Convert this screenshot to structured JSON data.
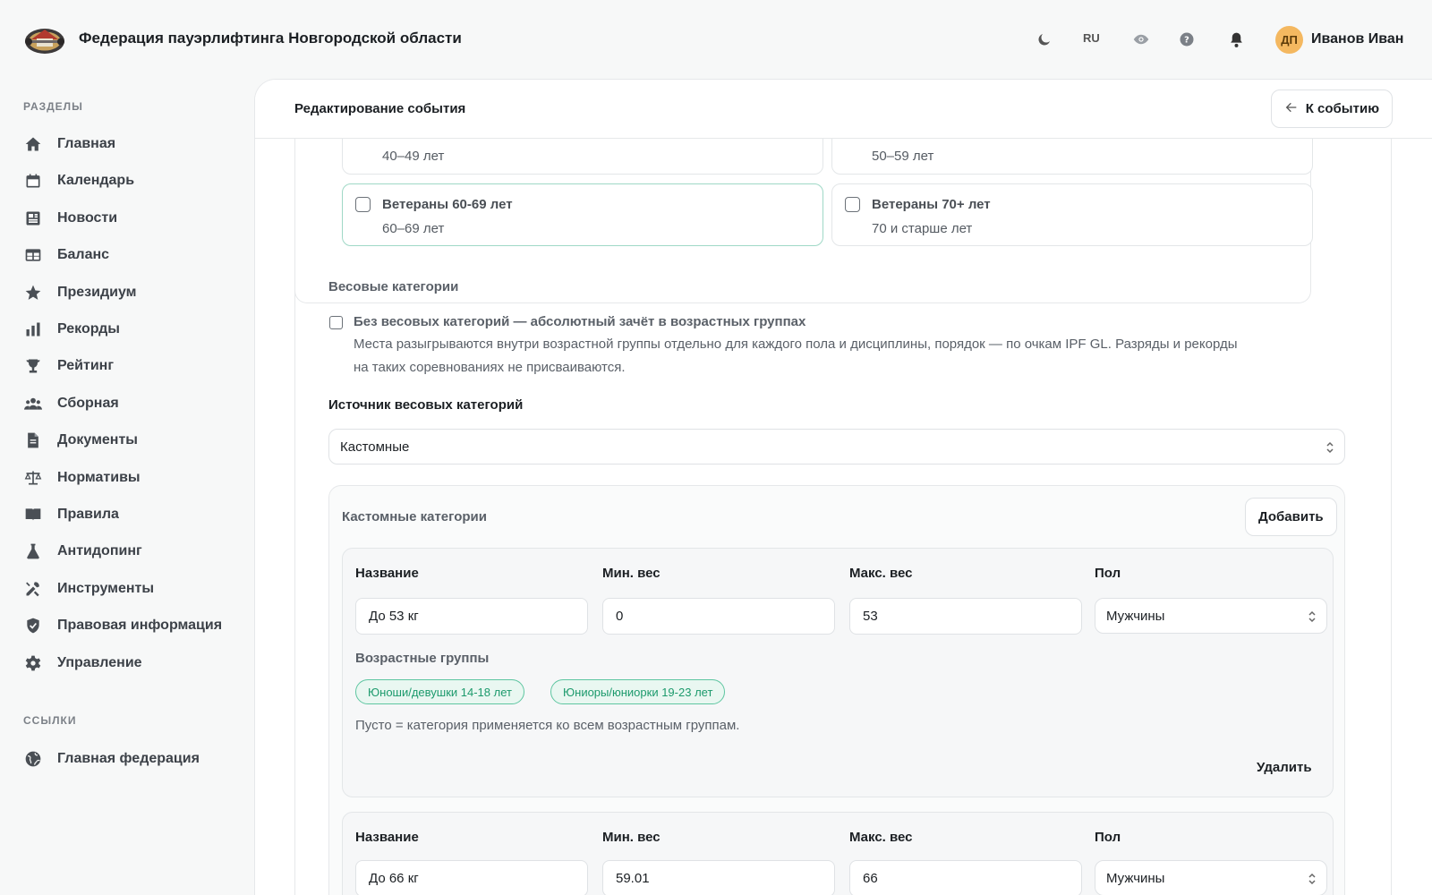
{
  "header": {
    "brand_title": "Федерация пауэрлифтинга Новгородской области",
    "lang": "RU",
    "avatar_initials": "ДП",
    "username": "Иванов Иван"
  },
  "sidebar": {
    "sections_heading": "РАЗДЕЛЫ",
    "items": [
      {
        "label": "Главная",
        "icon": "home-icon"
      },
      {
        "label": "Календарь",
        "icon": "calendar-icon"
      },
      {
        "label": "Новости",
        "icon": "news-icon"
      },
      {
        "label": "Баланс",
        "icon": "table-icon"
      },
      {
        "label": "Президиум",
        "icon": "star-icon"
      },
      {
        "label": "Рекорды",
        "icon": "bar-chart-icon"
      },
      {
        "label": "Рейтинг",
        "icon": "trophy-icon"
      },
      {
        "label": "Сборная",
        "icon": "team-icon"
      },
      {
        "label": "Документы",
        "icon": "document-icon"
      },
      {
        "label": "Нормативы",
        "icon": "scales-icon"
      },
      {
        "label": "Правила",
        "icon": "book-icon"
      },
      {
        "label": "Антидопинг",
        "icon": "flask-icon"
      },
      {
        "label": "Инструменты",
        "icon": "tools-icon"
      },
      {
        "label": "Правовая информация",
        "icon": "shield-icon"
      },
      {
        "label": "Управление",
        "icon": "gear-icon"
      }
    ],
    "links_heading": "ССЫЛКИ",
    "links": [
      {
        "label": "Главная федерация",
        "icon": "globe-icon"
      }
    ]
  },
  "main": {
    "page_title": "Редактирование события",
    "back_label": "К событию",
    "age_groups": [
      {
        "subtitle": "40–49 лет",
        "active": false
      },
      {
        "subtitle": "50–59 лет",
        "active": false
      },
      {
        "title": "Ветераны 60-69 лет",
        "subtitle": "60–69 лет",
        "active": true
      },
      {
        "title": "Ветераны 70+ лет",
        "subtitle": "70 и старше лет",
        "active": false
      }
    ],
    "weight_section_label": "Весовые категории",
    "no_weight_label": "Без весовых категорий — абсолютный зачёт в возрастных группах",
    "no_weight_desc_1": "Места разыгрываются внутри возрастной группы отдельно для каждого пола и дисциплины, порядок — по очкам IPF GL. Разряды и рекорды",
    "no_weight_desc_2": "на таких соревнованиях не присваиваются.",
    "source_label": "Источник весовых категорий",
    "source_value": "Кастомные",
    "custom_label": "Кастомные категории",
    "add_label": "Добавить",
    "categories": [
      {
        "name_label": "Название",
        "name": "До 53 кг",
        "min_label": "Мин. вес",
        "min": "0",
        "max_label": "Макс. вес",
        "max": "53",
        "sex_label": "Пол",
        "sex": "Мужчины",
        "age_label": "Возрастные группы",
        "chips": [
          "Юноши/девушки 14-18 лет",
          "Юниоры/юниорки 19-23 лет"
        ],
        "hint": "Пусто = категория применяется ко всем возрастным группам.",
        "delete_label": "Удалить"
      },
      {
        "name_label": "Название",
        "name": "До 66 кг",
        "min_label": "Мин. вес",
        "min": "59.01",
        "max_label": "Макс. вес",
        "max": "66",
        "sex_label": "Пол",
        "sex": "Мужчины"
      }
    ]
  }
}
